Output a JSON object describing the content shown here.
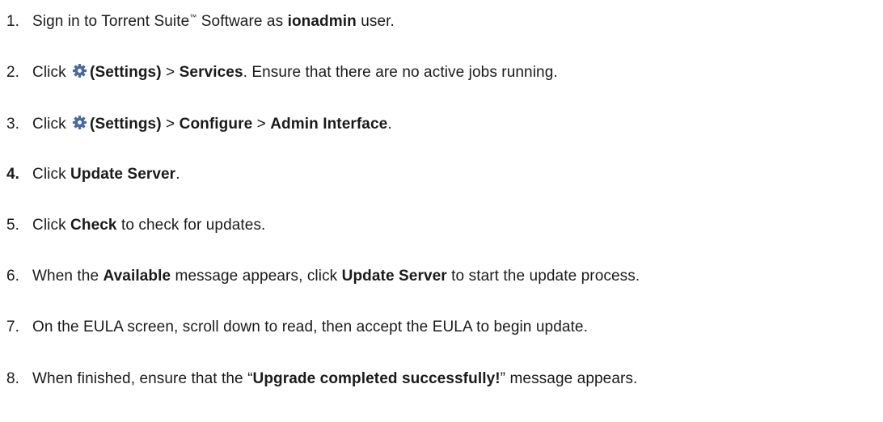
{
  "steps": [
    {
      "number": "1.",
      "parts": [
        "Sign in to Torrent Suite",
        "™",
        " Software as ",
        "ionadmin",
        " user."
      ]
    },
    {
      "number": "2.",
      "parts": [
        "Click ",
        "(Settings)",
        " > ",
        "Services",
        ". Ensure that there are no active jobs running."
      ],
      "icon": "gear-icon"
    },
    {
      "number": "3.",
      "parts": [
        "Click ",
        "(Settings)",
        " > ",
        "Configure",
        " > ",
        "Admin Interface",
        "."
      ],
      "icon": "gear-icon"
    },
    {
      "number": "4.",
      "parts": [
        "Click ",
        "Update Server",
        "."
      ]
    },
    {
      "number": "5.",
      "parts": [
        "Click ",
        "Check",
        " to check for updates."
      ]
    },
    {
      "number": "6.",
      "parts": [
        "When the ",
        "Available",
        " message appears, click ",
        "Update Server",
        " to start the update process."
      ]
    },
    {
      "number": "7.",
      "parts": [
        "On the EULA screen, scroll down to read, then accept the EULA to begin update."
      ]
    },
    {
      "number": "8.",
      "parts": [
        "When finished, ensure that the “",
        "Upgrade completed successfully!",
        "” message appears."
      ]
    }
  ],
  "colors": {
    "text": "#1a1a1a",
    "gear_icon": "#4a6a9c"
  }
}
